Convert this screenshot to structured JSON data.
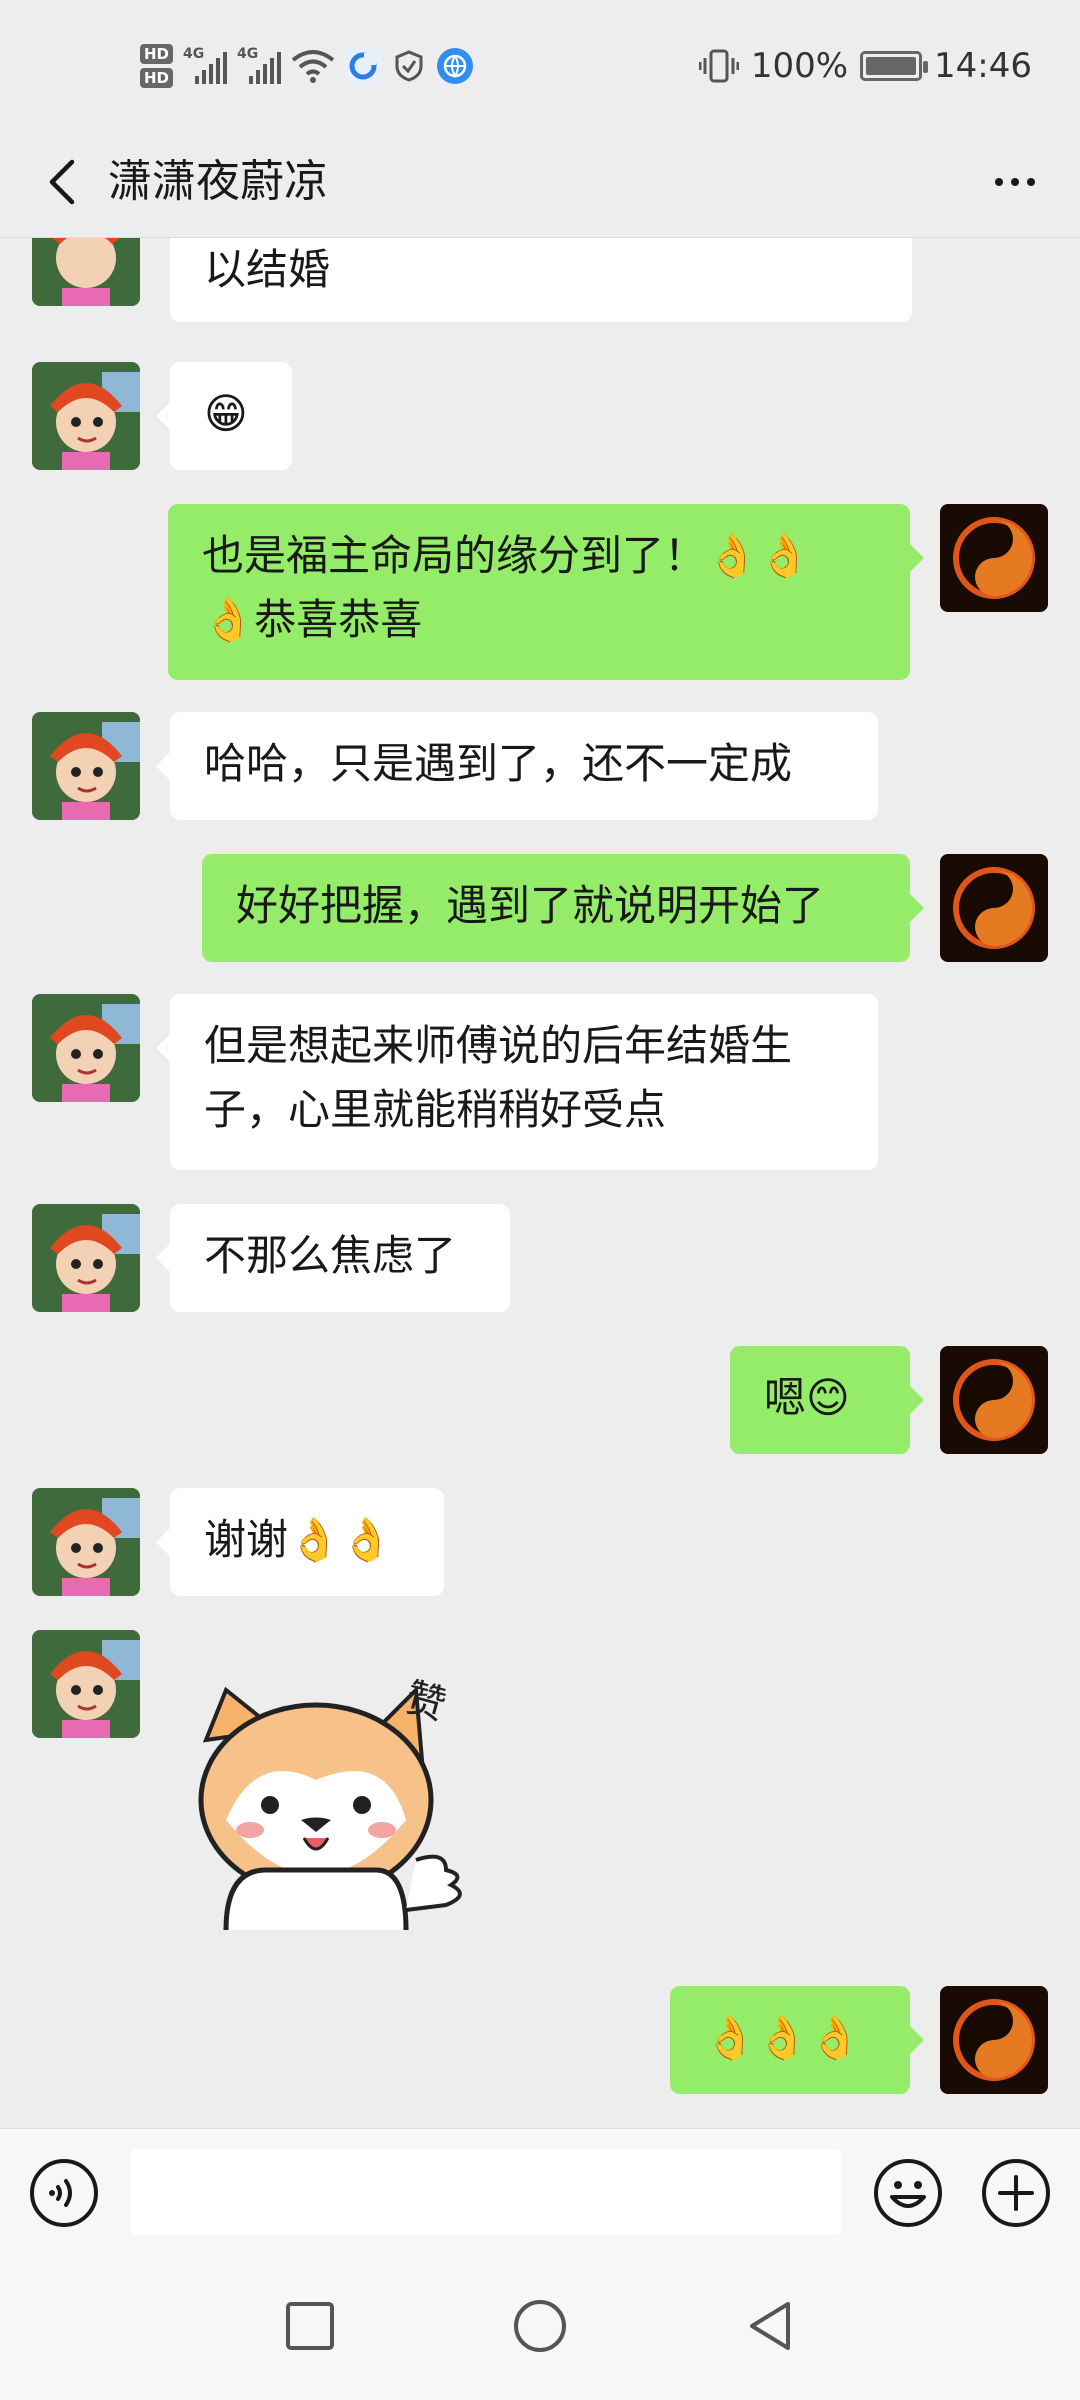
{
  "status_bar": {
    "hd1": "HD",
    "hd2": "HD",
    "sim1_label": "4G",
    "sim2_label": "4G",
    "battery_percent": "100%",
    "time": "14:46"
  },
  "nav": {
    "title": "潇潇夜蔚凉"
  },
  "messages": [
    {
      "side": "in",
      "text": "以结婚"
    },
    {
      "side": "in",
      "text": "😁"
    },
    {
      "side": "out",
      "line1": "也是福主命局的缘分到了！👌👌",
      "line2": "👌恭喜恭喜"
    },
    {
      "side": "in",
      "text": "哈哈，只是遇到了，还不一定成"
    },
    {
      "side": "out",
      "text": "好好把握，遇到了就说明开始了"
    },
    {
      "side": "in",
      "line1": "但是想起来师傅说的后年结婚生",
      "line2": "子，心里就能稍稍好受点"
    },
    {
      "side": "in",
      "text": "不那么焦虑了"
    },
    {
      "side": "out",
      "text": "嗯😊"
    },
    {
      "side": "in",
      "text": "谢谢👌👌"
    },
    {
      "side": "in",
      "type": "sticker",
      "sticker_text": "赞"
    },
    {
      "side": "out",
      "text": "👌👌👌"
    }
  ],
  "input_bar": {
    "placeholder": ""
  },
  "colors": {
    "background": "#ededed",
    "outgoing_bubble": "#95ec69",
    "incoming_bubble": "#ffffff"
  },
  "icons": {
    "back": "chevron-left-icon",
    "more": "more-dots-icon",
    "voice": "voice-icon",
    "emoji": "emoji-icon",
    "plus": "plus-icon",
    "recent": "square-icon",
    "home": "circle-icon",
    "back_nav": "triangle-back-icon"
  }
}
